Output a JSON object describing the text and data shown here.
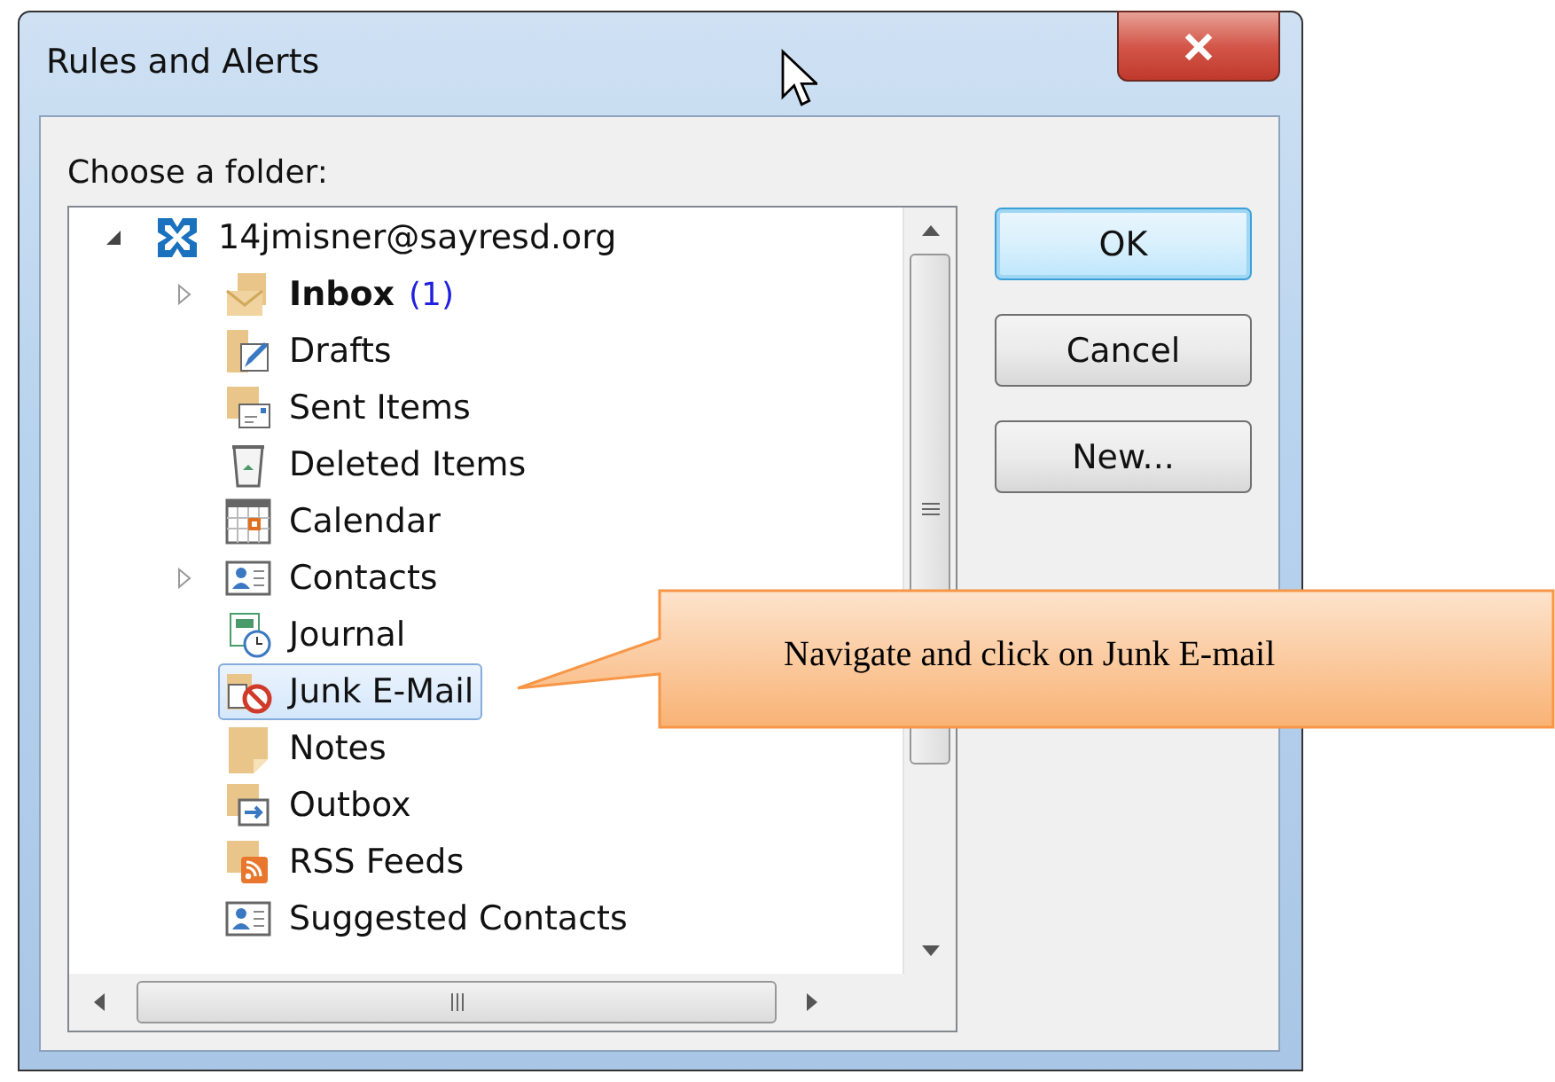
{
  "window": {
    "title": "Rules and Alerts"
  },
  "folder_label": "Choose a folder:",
  "tree": [
    {
      "label": "14jmisner@sayresd.org",
      "kind": "account",
      "expanded": true,
      "selected": false,
      "children": [
        {
          "label": "Inbox",
          "kind": "inbox",
          "unread": "(1)",
          "expanded": false,
          "selected": false
        },
        {
          "label": "Drafts",
          "kind": "drafts",
          "selected": false
        },
        {
          "label": "Sent Items",
          "kind": "sent",
          "selected": false
        },
        {
          "label": "Deleted Items",
          "kind": "deleted",
          "selected": false
        },
        {
          "label": "Calendar",
          "kind": "calendar",
          "selected": false
        },
        {
          "label": "Contacts",
          "kind": "contacts",
          "expanded": false,
          "selected": false
        },
        {
          "label": "Journal",
          "kind": "journal",
          "selected": false
        },
        {
          "label": "Junk E-Mail",
          "kind": "junk",
          "selected": true
        },
        {
          "label": "Notes",
          "kind": "notes",
          "selected": false
        },
        {
          "label": "Outbox",
          "kind": "outbox",
          "selected": false
        },
        {
          "label": "RSS Feeds",
          "kind": "rss",
          "selected": false
        },
        {
          "label": "Suggested Contacts",
          "kind": "contacts",
          "selected": false
        }
      ]
    }
  ],
  "buttons": [
    {
      "label": "OK",
      "default": true
    },
    {
      "label": "Cancel",
      "default": false
    },
    {
      "label": "New...",
      "default": false
    }
  ],
  "callout": {
    "text": "Navigate and click on Junk E-mail"
  }
}
